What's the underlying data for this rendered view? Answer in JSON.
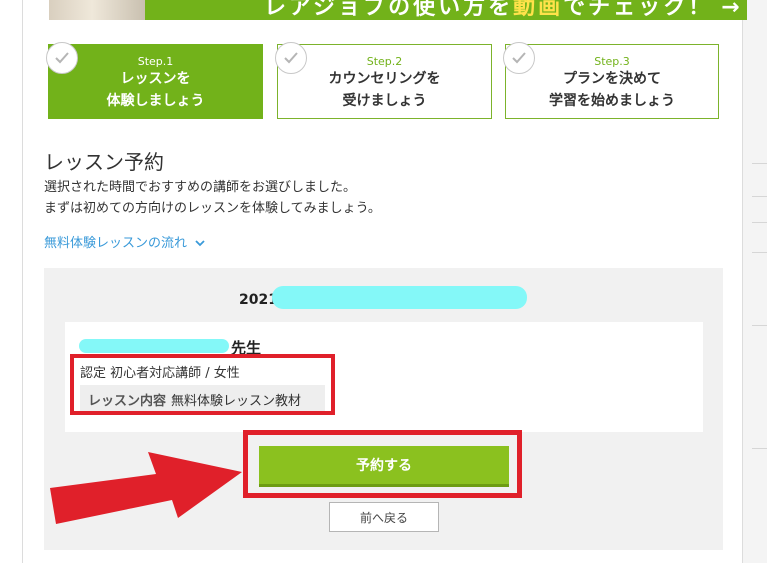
{
  "banner": {
    "text_prefix": "レアジョブの使い方を",
    "text_highlight": "動画",
    "text_suffix": "でチェック！",
    "arrow": "→"
  },
  "steps": [
    {
      "num": "Step.1",
      "line1": "レッスンを",
      "line2": "体験しましょう",
      "active": true
    },
    {
      "num": "Step.2",
      "line1": "カウンセリングを",
      "line2": "受けましょう",
      "active": false
    },
    {
      "num": "Step.3",
      "line1": "プランを決めて",
      "line2": "学習を始めましょう",
      "active": false
    }
  ],
  "main": {
    "title": "レッスン予約",
    "desc_line1": "選択された時間でおすすめの講師をお選びしました。",
    "desc_line2": "まずは初めての方向けのレッスンを体験してみましょう。",
    "flow_link": "無料体験レッスンの流れ"
  },
  "booking": {
    "date_prefix": "2021",
    "teacher_suffix": "先生",
    "meta": "認定 初心者対応講師 / 女性",
    "lesson_label": "レッスン内容",
    "lesson_value": "無料体験レッスン教材",
    "reserve_label": "予約する",
    "back_label": "前へ戻る"
  },
  "colors": {
    "brand_green": "#72b21a",
    "button_green": "#8bc11f",
    "link_blue": "#3a9ad9",
    "annotation_red": "#e0202a",
    "mask_cyan": "#84f8f8"
  },
  "icons": {
    "step_check": "check-icon",
    "flow_chevron": "chevron-down-icon",
    "annotation_arrow": "red-arrow-icon"
  }
}
